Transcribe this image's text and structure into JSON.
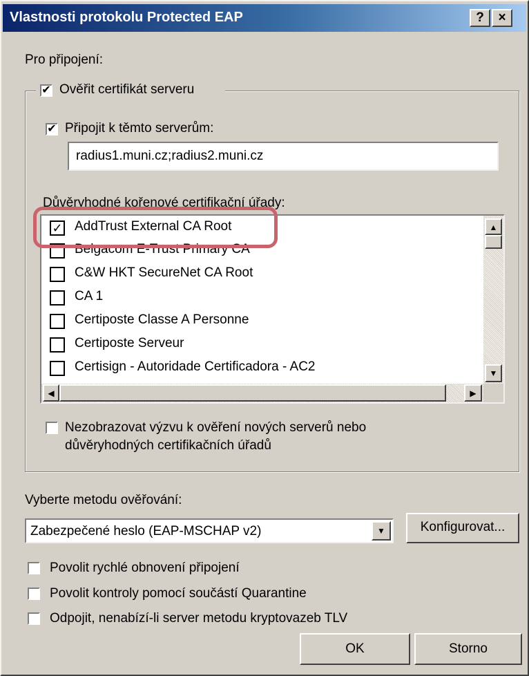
{
  "window": {
    "title": "Vlastnosti protokolu Protected EAP",
    "help_button": "?",
    "close_button": "×"
  },
  "connection_label": "Pro připojení:",
  "verify_cert": {
    "label": "Ověřit certifikát serveru",
    "checked": true
  },
  "connect_servers": {
    "label": "Připojit k těmto serverům:",
    "checked": true,
    "value": "radius1.muni.cz;radius2.muni.cz"
  },
  "trusted_ca_label": "Důvěryhodné kořenové certifikační úřady:",
  "ca_list": [
    {
      "label": "AddTrust External CA Root",
      "checked": true
    },
    {
      "label": "Belgacom E-Trust Primary CA",
      "checked": false
    },
    {
      "label": "C&W HKT SecureNet CA Root",
      "checked": false
    },
    {
      "label": "CA 1",
      "checked": false
    },
    {
      "label": "Certiposte Classe A Personne",
      "checked": false
    },
    {
      "label": "Certiposte Serveur",
      "checked": false
    },
    {
      "label": "Certisign - Autoridade Certificadora - AC2",
      "checked": false
    }
  ],
  "no_prompt": {
    "line1": "Nezobrazovat výzvu k ověření nových serverů nebo",
    "line2": "důvěryhodných certifikačních úřadů",
    "checked": false
  },
  "auth_method": {
    "label": "Vyberte metodu ověřování:",
    "selected": "Zabezpečené heslo (EAP-MSCHAP v2)",
    "configure_button": "Konfigurovat..."
  },
  "options": [
    {
      "label": "Povolit rychlé obnovení připojení",
      "checked": false
    },
    {
      "label": "Povolit kontroly pomocí součástí Quarantine",
      "checked": false
    },
    {
      "label": "Odpojit, nenabízí-li server metodu kryptovazeb TLV",
      "checked": false
    }
  ],
  "buttons": {
    "ok": "OK",
    "cancel": "Storno"
  },
  "colors": {
    "titlebar_start": "#0a246a",
    "titlebar_end": "#a6caf0",
    "dialog_bg": "#d4d0c8",
    "highlight": "#c9646a"
  }
}
